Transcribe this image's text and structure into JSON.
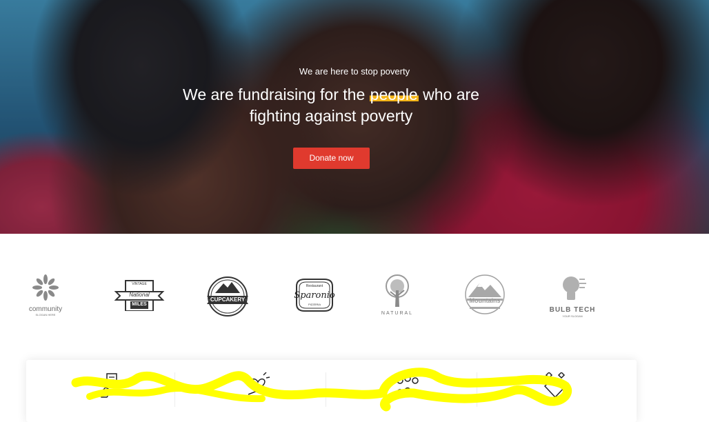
{
  "hero": {
    "tagline": "We are here to stop poverty",
    "title_before": "We are fundraising for the",
    "title_highlight": "people",
    "title_after": "who are fighting against poverty",
    "donate_label": "Donate now",
    "colors": {
      "button": "#e03a2e",
      "highlight": "#f3b417"
    }
  },
  "logos": [
    {
      "name": "community",
      "text": "community",
      "subtext": "SLOGAN HERE",
      "icon": "flower-icon"
    },
    {
      "name": "national-miles",
      "text_top": "VINTAGE",
      "text": "National",
      "text_bottom": "MILES",
      "icon": "banner-badge-icon"
    },
    {
      "name": "cupcakery",
      "text": "CUPCAKERY",
      "icon": "mountain-badge-icon"
    },
    {
      "name": "sparonio",
      "text_top": "Restaurant",
      "text": "Sparonio",
      "text_bottom": "PIZZERIA",
      "icon": "oval-badge-icon"
    },
    {
      "name": "natural",
      "text": "NATURAL",
      "icon": "tree-icon"
    },
    {
      "name": "mountains",
      "text": "Mountains",
      "icon": "mountain-circle-icon"
    },
    {
      "name": "bulb-tech",
      "text": "BULB TECH",
      "subtext": "YOUR SLOGAN",
      "icon": "lightbulb-icon"
    }
  ],
  "features": [
    {
      "icon": "hand-document-icon"
    },
    {
      "icon": "hand-heart-icon"
    },
    {
      "icon": "people-group-icon"
    },
    {
      "icon": "diamond-icon"
    }
  ],
  "annotation": {
    "color": "#ffff00"
  }
}
